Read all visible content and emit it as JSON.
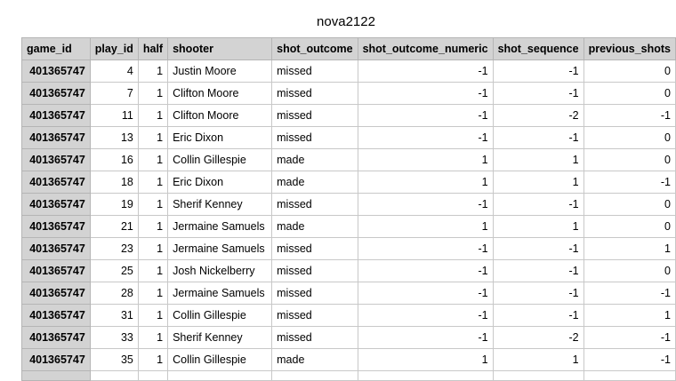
{
  "title": "nova2122",
  "columns": [
    "game_id",
    "play_id",
    "half",
    "shooter",
    "shot_outcome",
    "shot_outcome_numeric",
    "shot_sequence",
    "previous_shots"
  ],
  "rows": [
    [
      "401365747",
      "4",
      "1",
      "Justin Moore",
      "missed",
      "-1",
      "-1",
      "0"
    ],
    [
      "401365747",
      "7",
      "1",
      "Clifton Moore",
      "missed",
      "-1",
      "-1",
      "0"
    ],
    [
      "401365747",
      "11",
      "1",
      "Clifton Moore",
      "missed",
      "-1",
      "-2",
      "-1"
    ],
    [
      "401365747",
      "13",
      "1",
      "Eric Dixon",
      "missed",
      "-1",
      "-1",
      "0"
    ],
    [
      "401365747",
      "16",
      "1",
      "Collin Gillespie",
      "made",
      "1",
      "1",
      "0"
    ],
    [
      "401365747",
      "18",
      "1",
      "Eric Dixon",
      "made",
      "1",
      "1",
      "-1"
    ],
    [
      "401365747",
      "19",
      "1",
      "Sherif Kenney",
      "missed",
      "-1",
      "-1",
      "0"
    ],
    [
      "401365747",
      "21",
      "1",
      "Jermaine Samuels",
      "made",
      "1",
      "1",
      "0"
    ],
    [
      "401365747",
      "23",
      "1",
      "Jermaine Samuels",
      "missed",
      "-1",
      "-1",
      "1"
    ],
    [
      "401365747",
      "25",
      "1",
      "Josh Nickelberry",
      "missed",
      "-1",
      "-1",
      "0"
    ],
    [
      "401365747",
      "28",
      "1",
      "Jermaine Samuels",
      "missed",
      "-1",
      "-1",
      "-1"
    ],
    [
      "401365747",
      "31",
      "1",
      "Collin Gillespie",
      "missed",
      "-1",
      "-1",
      "1"
    ],
    [
      "401365747",
      "33",
      "1",
      "Sherif Kenney",
      "missed",
      "-1",
      "-2",
      "-1"
    ],
    [
      "401365747",
      "35",
      "1",
      "Collin Gillespie",
      "made",
      "1",
      "1",
      "-1"
    ]
  ]
}
